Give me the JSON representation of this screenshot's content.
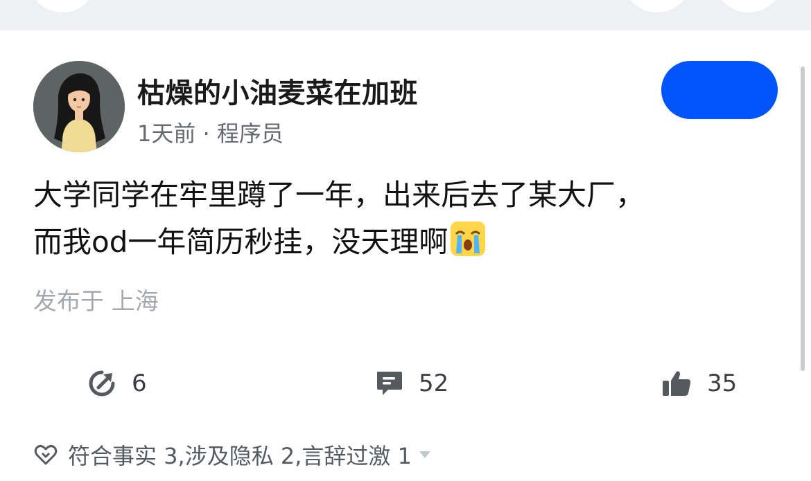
{
  "post": {
    "author": {
      "name": "枯燥的小油麦菜在加班",
      "meta": "1天前 · 程序员",
      "avatar_icon": "girl-avatar-illustration"
    },
    "follow_button": {
      "color": "#0054fa",
      "label": ""
    },
    "content_lines": [
      "大学同学在牢里蹲了一年，出来后去了某大厂，",
      "而我od一年简历秒挂，没天理啊"
    ],
    "content_emoji": "crying-face-emoji",
    "location": "发布于 上海",
    "actions": {
      "share": {
        "icon": "share-icon",
        "count": "6"
      },
      "comment": {
        "icon": "comment-icon",
        "count": "52"
      },
      "like": {
        "icon": "thumbs-up-icon",
        "count": "35"
      }
    },
    "tags": {
      "icon": "heart-tag-icon",
      "text": "符合事实 3,涉及隐私 2,言辞过激 1",
      "dropdown_icon": "caret-down-icon"
    }
  },
  "colors": {
    "accent": "#0054fa",
    "text_primary": "#111111",
    "text_secondary": "#666a70",
    "text_muted": "#a5a9ae"
  }
}
